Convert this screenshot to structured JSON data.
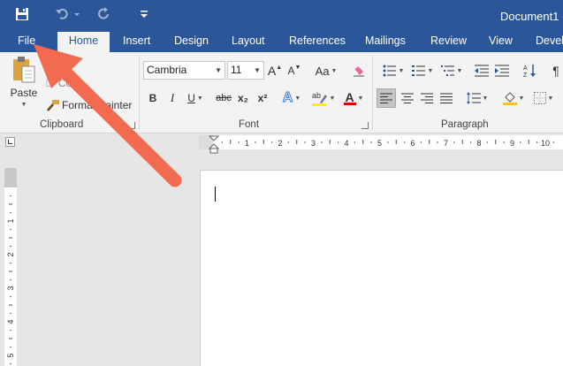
{
  "app": {
    "document_title": "Document1 -",
    "accent_color": "#2b579a",
    "annotation_arrow_color": "#f26a4f"
  },
  "quick_access": {
    "save_icon": "save-icon",
    "undo_icon": "undo-icon",
    "redo_icon": "redo-icon",
    "customize_icon": "customize-qat-icon"
  },
  "tabs": [
    {
      "label": "File",
      "active": false
    },
    {
      "label": "Home",
      "active": true
    },
    {
      "label": "Insert",
      "active": false
    },
    {
      "label": "Design",
      "active": false
    },
    {
      "label": "Layout",
      "active": false
    },
    {
      "label": "References",
      "active": false
    },
    {
      "label": "Mailings",
      "active": false
    },
    {
      "label": "Review",
      "active": false
    },
    {
      "label": "View",
      "active": false
    },
    {
      "label": "Devel",
      "active": false
    }
  ],
  "clipboard": {
    "group_label": "Clipboard",
    "paste_label": "Paste",
    "cut_label": "Cut",
    "copy_label": "Co",
    "format_painter_label": "Format Painter"
  },
  "font": {
    "group_label": "Font",
    "font_name": "Cambria",
    "font_size": "11",
    "bold": "B",
    "italic": "I",
    "underline": "U",
    "strikethrough": "abc",
    "subscript": "x₂",
    "superscript": "x²",
    "change_case": "Aa",
    "grow_font": "A",
    "shrink_font": "A"
  },
  "paragraph": {
    "group_label": "Paragraph"
  },
  "ruler": {
    "h_numbers": [
      "1",
      "2",
      "3",
      "4",
      "5",
      "6",
      "7",
      "8",
      "9",
      "10"
    ],
    "v_numbers": [
      "1",
      "2",
      "3",
      "4",
      "5"
    ]
  }
}
